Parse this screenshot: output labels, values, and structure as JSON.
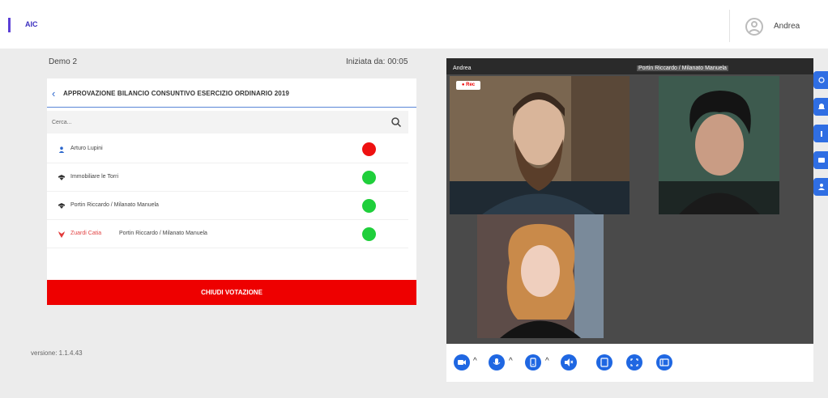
{
  "header": {
    "brand": "AIC",
    "user_name": "Andrea"
  },
  "meeting": {
    "name": "Demo 2",
    "started_label": "Iniziata da:",
    "started_time": "00:05"
  },
  "vote_panel": {
    "title": "APPROVAZIONE BILANCIO CONSUNTIVO ESERCIZIO ORDINARIO 2019",
    "search_placeholder": "Cerca...",
    "participants": [
      {
        "name": "Arturo Lupini",
        "sub": "",
        "icon": "user-icon",
        "status": "red"
      },
      {
        "name": "Immobiliare le Torri",
        "sub": "",
        "icon": "company-icon",
        "status": "green"
      },
      {
        "name": "Portin Riccardo / Milanato Manuela",
        "sub": "",
        "icon": "company-icon",
        "status": "green"
      },
      {
        "name": "Zuardi Catia",
        "sub": "Portin Riccardo / Milanato Manuela",
        "icon": "delegate-icon",
        "status": "green"
      }
    ],
    "close_button": "CHIUDI VOTAZIONE"
  },
  "version": "versione: 1.1.4.43",
  "video": {
    "left_label": "Andrea",
    "right_label": "Portin Riccardo / Milanato Manuela",
    "rec_label": "● Rec"
  },
  "colors": {
    "accent": "#1f67e2",
    "danger": "#ee0000",
    "online": "#1fcf3b",
    "offline": "#ee1111"
  }
}
